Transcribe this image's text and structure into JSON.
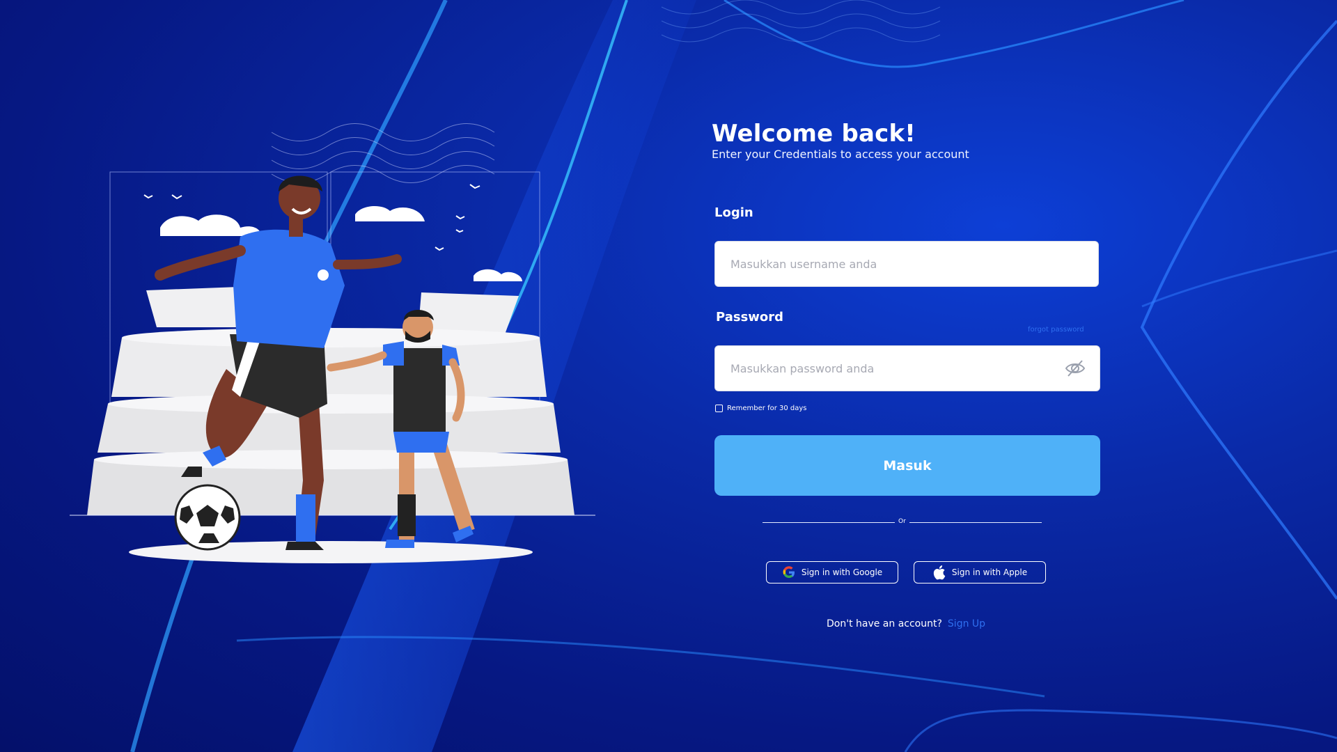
{
  "header": {
    "title": "Welcome back!",
    "subtitle": "Enter your Credentials to access your account"
  },
  "form": {
    "login_label": "Login",
    "username_placeholder": "Masukkan username anda",
    "password_label": "Password",
    "forgot_password": "forgot password",
    "password_placeholder": "Masukkan password anda",
    "remember_label": "Remember for 30 days",
    "submit_label": "Masuk"
  },
  "divider": {
    "text": "Or"
  },
  "social": {
    "google_label": "Sign in with Google",
    "apple_label": "Sign in with Apple"
  },
  "footer": {
    "prompt": "Don't have an account?",
    "signup_link": "Sign Up"
  },
  "colors": {
    "background": "#0a2aa8",
    "primary_button": "#4fb1f8",
    "link": "#2f6ff0"
  }
}
